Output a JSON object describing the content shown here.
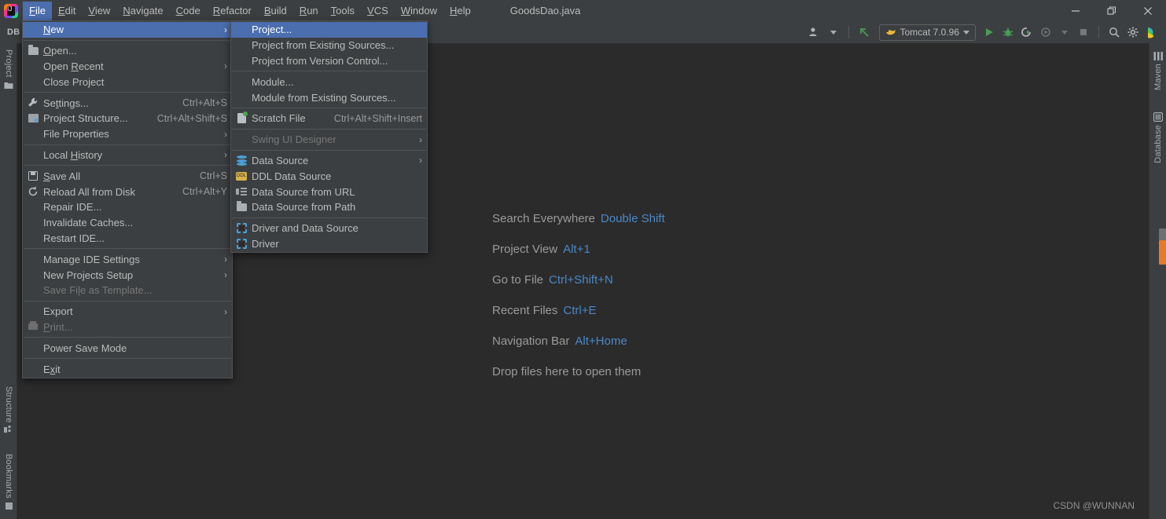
{
  "window": {
    "title": "GoodsDao.java",
    "app_icon": "intellij-logo-icon",
    "controls": {
      "minimize": "minimize-icon",
      "restore": "restore-icon",
      "close": "close-icon"
    }
  },
  "menubar": {
    "items": [
      {
        "label": "File",
        "active": true
      },
      {
        "label": "Edit",
        "active": false
      },
      {
        "label": "View",
        "active": false
      },
      {
        "label": "Navigate",
        "active": false
      },
      {
        "label": "Code",
        "active": false
      },
      {
        "label": "Refactor",
        "active": false
      },
      {
        "label": "Build",
        "active": false
      },
      {
        "label": "Run",
        "active": false
      },
      {
        "label": "Tools",
        "active": false
      },
      {
        "label": "VCS",
        "active": false
      },
      {
        "label": "Window",
        "active": false
      },
      {
        "label": "Help",
        "active": false
      }
    ]
  },
  "toolbar": {
    "left_label": "DB",
    "run_config": {
      "label": "Tomcat 7.0.96",
      "icon": "tomcat-icon"
    },
    "buttons": [
      {
        "name": "user-account-button",
        "icon": "user-icon"
      },
      {
        "name": "update-project-button",
        "icon": "arrow-update-icon"
      },
      {
        "name": "run-button",
        "icon": "run-play-icon"
      },
      {
        "name": "debug-button",
        "icon": "debug-bug-icon"
      },
      {
        "name": "run-coverage-button",
        "icon": "run-coverage-icon"
      },
      {
        "name": "profiler-button",
        "icon": "profiler-icon"
      },
      {
        "name": "stop-button",
        "icon": "stop-square-icon"
      },
      {
        "name": "search-button",
        "icon": "search-icon"
      },
      {
        "name": "settings-button",
        "icon": "gear-icon"
      },
      {
        "name": "ide-assistant-button",
        "icon": "assistant-icon"
      }
    ]
  },
  "file_menu": {
    "items": [
      {
        "label": "New",
        "mnemonic": "N",
        "icon": null,
        "shortcut": null,
        "submenu": true,
        "selected": true,
        "disabled": false
      },
      {
        "separator": true
      },
      {
        "label": "Open...",
        "mnemonic": "O",
        "icon": "folder-open-icon",
        "shortcut": null,
        "submenu": false,
        "selected": false,
        "disabled": false
      },
      {
        "label": "Open Recent",
        "mnemonic": "R",
        "icon": null,
        "shortcut": null,
        "submenu": true,
        "selected": false,
        "disabled": false
      },
      {
        "label": "Close Project",
        "mnemonic": null,
        "icon": null,
        "shortcut": null,
        "submenu": false,
        "selected": false,
        "disabled": false
      },
      {
        "separator": true
      },
      {
        "label": "Settings...",
        "mnemonic": "t",
        "icon": "wrench-icon",
        "shortcut": "Ctrl+Alt+S",
        "submenu": false,
        "selected": false,
        "disabled": false
      },
      {
        "label": "Project Structure...",
        "mnemonic": null,
        "icon": "project-structure-icon",
        "shortcut": "Ctrl+Alt+Shift+S",
        "submenu": false,
        "selected": false,
        "disabled": false
      },
      {
        "label": "File Properties",
        "mnemonic": null,
        "icon": null,
        "shortcut": null,
        "submenu": true,
        "selected": false,
        "disabled": false
      },
      {
        "separator": true
      },
      {
        "label": "Local History",
        "mnemonic": "H",
        "icon": null,
        "shortcut": null,
        "submenu": true,
        "selected": false,
        "disabled": false
      },
      {
        "separator": true
      },
      {
        "label": "Save All",
        "mnemonic": "S",
        "icon": "save-icon",
        "shortcut": "Ctrl+S",
        "submenu": false,
        "selected": false,
        "disabled": false
      },
      {
        "label": "Reload All from Disk",
        "mnemonic": null,
        "icon": "reload-icon",
        "shortcut": "Ctrl+Alt+Y",
        "submenu": false,
        "selected": false,
        "disabled": false
      },
      {
        "label": "Repair IDE...",
        "mnemonic": null,
        "icon": null,
        "shortcut": null,
        "submenu": false,
        "selected": false,
        "disabled": false
      },
      {
        "label": "Invalidate Caches...",
        "mnemonic": null,
        "icon": null,
        "shortcut": null,
        "submenu": false,
        "selected": false,
        "disabled": false
      },
      {
        "label": "Restart IDE...",
        "mnemonic": null,
        "icon": null,
        "shortcut": null,
        "submenu": false,
        "selected": false,
        "disabled": false
      },
      {
        "separator": true
      },
      {
        "label": "Manage IDE Settings",
        "mnemonic": null,
        "icon": null,
        "shortcut": null,
        "submenu": true,
        "selected": false,
        "disabled": false
      },
      {
        "label": "New Projects Setup",
        "mnemonic": null,
        "icon": null,
        "shortcut": null,
        "submenu": true,
        "selected": false,
        "disabled": false
      },
      {
        "label": "Save File as Template...",
        "mnemonic": "l",
        "icon": null,
        "shortcut": null,
        "submenu": false,
        "selected": false,
        "disabled": true
      },
      {
        "separator": true
      },
      {
        "label": "Export",
        "mnemonic": null,
        "icon": null,
        "shortcut": null,
        "submenu": true,
        "selected": false,
        "disabled": false
      },
      {
        "label": "Print...",
        "mnemonic": "P",
        "icon": "print-icon",
        "shortcut": null,
        "submenu": false,
        "selected": false,
        "disabled": true
      },
      {
        "separator": true
      },
      {
        "label": "Power Save Mode",
        "mnemonic": null,
        "icon": null,
        "shortcut": null,
        "submenu": false,
        "selected": false,
        "disabled": false
      },
      {
        "separator": true
      },
      {
        "label": "Exit",
        "mnemonic": "x",
        "icon": null,
        "shortcut": null,
        "submenu": false,
        "selected": false,
        "disabled": false
      }
    ]
  },
  "new_submenu": {
    "items": [
      {
        "label": "Project...",
        "icon": null,
        "shortcut": null,
        "submenu": false,
        "selected": true,
        "disabled": false
      },
      {
        "label": "Project from Existing Sources...",
        "icon": null,
        "shortcut": null,
        "submenu": false,
        "selected": false,
        "disabled": false
      },
      {
        "label": "Project from Version Control...",
        "icon": null,
        "shortcut": null,
        "submenu": false,
        "selected": false,
        "disabled": false
      },
      {
        "separator": true
      },
      {
        "label": "Module...",
        "icon": null,
        "shortcut": null,
        "submenu": false,
        "selected": false,
        "disabled": false
      },
      {
        "label": "Module from Existing Sources...",
        "icon": null,
        "shortcut": null,
        "submenu": false,
        "selected": false,
        "disabled": false
      },
      {
        "separator": true
      },
      {
        "label": "Scratch File",
        "icon": "scratch-file-icon",
        "shortcut": "Ctrl+Alt+Shift+Insert",
        "submenu": false,
        "selected": false,
        "disabled": false
      },
      {
        "separator": true
      },
      {
        "label": "Swing UI Designer",
        "icon": null,
        "shortcut": null,
        "submenu": true,
        "selected": false,
        "disabled": true
      },
      {
        "separator": true
      },
      {
        "label": "Data Source",
        "icon": "database-icon",
        "shortcut": null,
        "submenu": true,
        "selected": false,
        "disabled": false
      },
      {
        "label": "DDL Data Source",
        "icon": "ddl-data-source-icon",
        "shortcut": null,
        "submenu": false,
        "selected": false,
        "disabled": false
      },
      {
        "label": "Data Source from URL",
        "icon": "data-source-url-icon",
        "shortcut": null,
        "submenu": false,
        "selected": false,
        "disabled": false
      },
      {
        "label": "Data Source from Path",
        "icon": "folder-open-icon",
        "shortcut": null,
        "submenu": false,
        "selected": false,
        "disabled": false
      },
      {
        "separator": true
      },
      {
        "label": "Driver and Data Source",
        "icon": "driver-icon",
        "shortcut": null,
        "submenu": false,
        "selected": false,
        "disabled": false
      },
      {
        "label": "Driver",
        "icon": "driver-icon",
        "shortcut": null,
        "submenu": false,
        "selected": false,
        "disabled": false
      }
    ]
  },
  "left_tool_window_bar": {
    "items": [
      {
        "label": "Project",
        "icon": "folder-icon"
      },
      {
        "label": "Structure",
        "icon": "structure-icon"
      },
      {
        "label": "Bookmarks",
        "icon": "bookmarks-icon"
      }
    ]
  },
  "right_tool_window_bar": {
    "items": [
      {
        "label": "Maven",
        "icon": "maven-icon"
      },
      {
        "label": "Database",
        "icon": "database-icon"
      }
    ]
  },
  "editor_hints": {
    "rows": [
      {
        "action": "Search Everywhere",
        "shortcut": "Double Shift"
      },
      {
        "action": "Project View",
        "shortcut": "Alt+1"
      },
      {
        "action": "Go to File",
        "shortcut": "Ctrl+Shift+N"
      },
      {
        "action": "Recent Files",
        "shortcut": "Ctrl+E"
      },
      {
        "action": "Navigation Bar",
        "shortcut": "Alt+Home"
      },
      {
        "action": "Drop files here to open them",
        "shortcut": ""
      }
    ]
  },
  "watermark": "CSDN @WUNNAN",
  "colors": {
    "background": "#2b2b2b",
    "chrome": "#3c3f41",
    "menu_bg": "#3c3f41",
    "selection": "#4b6eaf",
    "text": "#bbbbbb",
    "disabled_text": "#777777",
    "hint_key": "#4a88c7",
    "accent_green": "#499c54",
    "accent_orange": "#e8792b"
  }
}
